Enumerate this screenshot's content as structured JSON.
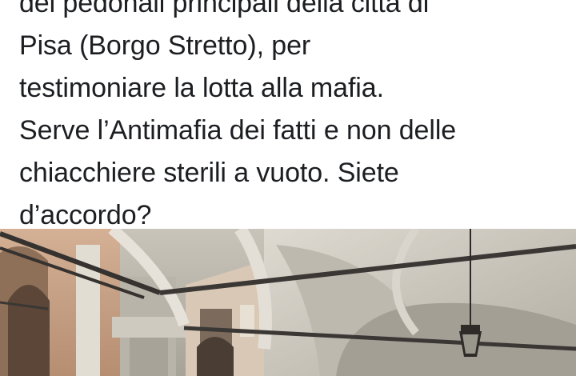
{
  "post": {
    "text_lines": [
      "dei pedonali principali della città di",
      "Pisa (Borgo Stretto), per",
      "testimoniare la lotta alla mafia.",
      "Serve l’Antimafia dei fatti e non delle",
      "chiacchiere sterili a vuoto. Siete",
      "d’accordo?"
    ]
  },
  "photo": {
    "subject": "arcade-portico-photo",
    "colors": {
      "vault": "#cfcbc2",
      "vault_shadow": "#9d998f",
      "building": "#c9a386",
      "beam": "#3a3734",
      "background": "#ffffff"
    }
  }
}
